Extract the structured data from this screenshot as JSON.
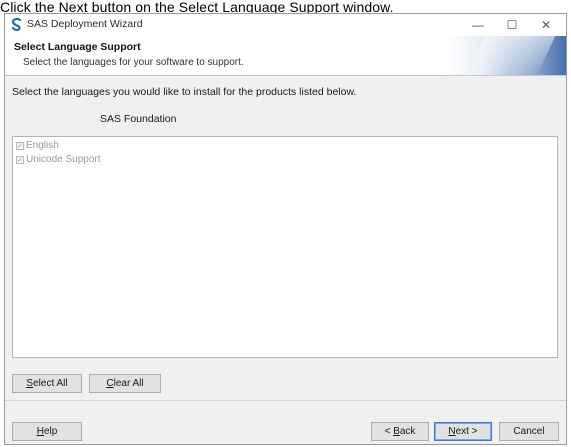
{
  "caption": "Click the Next button on the Select Language Support window.",
  "window": {
    "title": "SAS Deployment Wizard",
    "controls": {
      "minimize": "—",
      "maximize": "☐",
      "close": "✕"
    }
  },
  "header": {
    "title": "Select Language Support",
    "subtitle": "Select the languages for your software to support."
  },
  "instruction": "Select the languages you would like to install for the products listed below.",
  "product_label": "SAS Foundation",
  "languages": [
    {
      "label": "English",
      "checked": true,
      "enabled": false
    },
    {
      "label": "Unicode Support",
      "checked": true,
      "enabled": false
    }
  ],
  "selection_buttons": {
    "select_all": {
      "mnemonic": "S",
      "rest": "elect All"
    },
    "clear_all": {
      "mnemonic": "C",
      "rest": "lear All"
    }
  },
  "nav_buttons": {
    "help": {
      "mnemonic": "H",
      "rest": "elp"
    },
    "back": {
      "prefix": "< ",
      "mnemonic": "B",
      "rest": "ack"
    },
    "next": {
      "mnemonic": "N",
      "rest": "ext >"
    },
    "cancel": "Cancel"
  },
  "icons": {
    "app": "sas-logo-icon",
    "check": "✓"
  }
}
